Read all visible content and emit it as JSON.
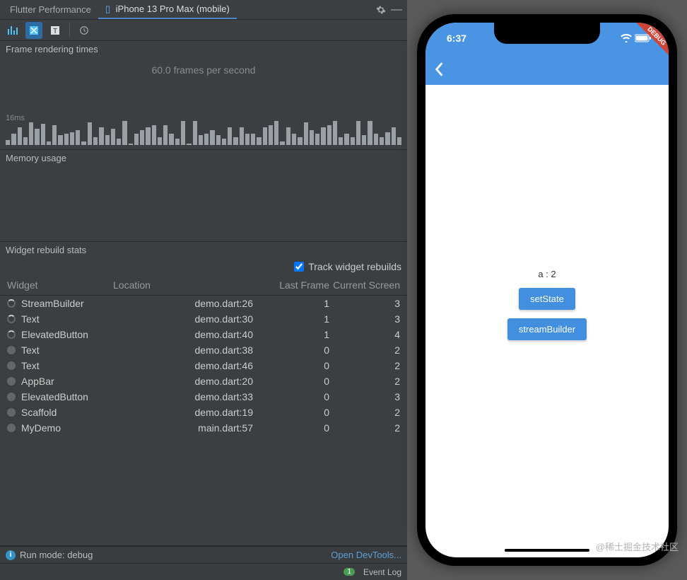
{
  "tabs": {
    "perf": "Flutter Performance",
    "device": "iPhone 13 Pro Max (mobile)"
  },
  "frame_section": {
    "title": "Frame rendering times",
    "fps": "60.0 frames per second",
    "threshold": "16ms"
  },
  "memory_section": {
    "title": "Memory usage"
  },
  "rebuild_section": {
    "title": "Widget rebuild stats",
    "checkbox": "Track widget rebuilds",
    "columns": {
      "widget": "Widget",
      "location": "Location",
      "last_frame": "Last Frame",
      "current_screen": "Current Screen"
    },
    "rows": [
      {
        "spin": true,
        "name": "StreamBuilder",
        "loc": "demo.dart:26",
        "lf": "1",
        "cs": "3"
      },
      {
        "spin": true,
        "name": "Text",
        "loc": "demo.dart:30",
        "lf": "1",
        "cs": "3"
      },
      {
        "spin": true,
        "name": "ElevatedButton",
        "loc": "demo.dart:40",
        "lf": "1",
        "cs": "4"
      },
      {
        "spin": false,
        "name": "Text",
        "loc": "demo.dart:38",
        "lf": "0",
        "cs": "2"
      },
      {
        "spin": false,
        "name": "Text",
        "loc": "demo.dart:46",
        "lf": "0",
        "cs": "2"
      },
      {
        "spin": false,
        "name": "AppBar",
        "loc": "demo.dart:20",
        "lf": "0",
        "cs": "2"
      },
      {
        "spin": false,
        "name": "ElevatedButton",
        "loc": "demo.dart:33",
        "lf": "0",
        "cs": "3"
      },
      {
        "spin": false,
        "name": "Scaffold",
        "loc": "demo.dart:19",
        "lf": "0",
        "cs": "2"
      },
      {
        "spin": false,
        "name": "MyDemo",
        "loc": "main.dart:57",
        "lf": "0",
        "cs": "2"
      }
    ]
  },
  "bottom": {
    "run_mode": "Run mode: debug",
    "devtools": "Open DevTools..."
  },
  "status": {
    "event_log": "Event Log",
    "event_count": "1"
  },
  "phone": {
    "time": "6:37",
    "debug": "DEBUG",
    "label": "a : 2",
    "btn1": "setState",
    "btn2": "streamBuilder"
  },
  "watermark": "@稀土掘金技术社区",
  "chart_data": {
    "type": "bar",
    "title": "Frame rendering times",
    "ylabel": "ms",
    "ylim": [
      0,
      40
    ],
    "threshold_ms": 16,
    "fps": 60.0,
    "values": [
      6,
      14,
      22,
      10,
      28,
      20,
      26,
      4,
      24,
      12,
      14,
      16,
      18,
      4,
      28,
      10,
      22,
      12,
      20,
      8,
      30,
      2,
      14,
      18,
      22,
      24,
      10,
      24,
      14,
      8,
      30,
      2,
      30,
      12,
      14,
      18,
      12,
      8,
      22,
      10,
      22,
      14,
      14,
      10,
      22,
      24,
      30,
      4,
      22,
      14,
      10,
      28,
      18,
      14,
      22,
      24,
      30,
      10,
      14,
      10,
      30,
      12,
      30,
      14,
      10,
      16,
      22,
      10
    ]
  }
}
